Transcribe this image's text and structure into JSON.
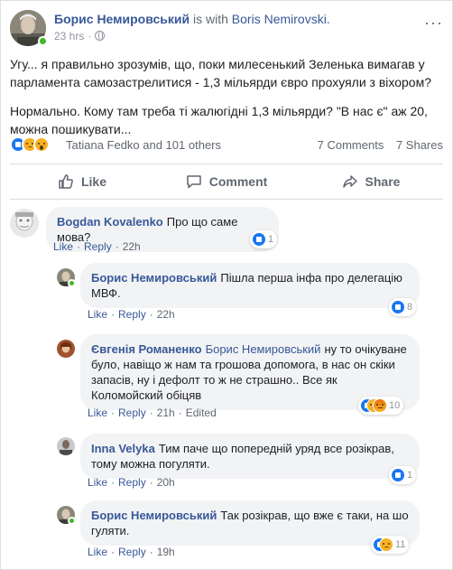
{
  "post": {
    "author": "Борис Немировський",
    "with_text": "is with",
    "tagged": "Boris Nemirovski.",
    "time": "23 hrs",
    "dot": "·",
    "more": "···",
    "paragraphs": [
      "Угу... я правильно зрозумів, що, поки милесенький Зеленька вимагав у парламента самозастрелитися - 1,3 мільярди євро прохуяли з віхором?",
      "Нормально. Кому там треба ті жалюгідні 1,3 мільярди? \"В нас є\" аж 20, можна пошикувати..."
    ],
    "reactions_text": "Tatiana Fedko and 101 others",
    "comments_count": "7 Comments",
    "shares_count": "7 Shares"
  },
  "actions": {
    "like": "Like",
    "comment": "Comment",
    "share": "Share"
  },
  "comments": [
    {
      "name": "Bogdan Kovalenko",
      "tag": "",
      "text": "Про що саме мова?",
      "like": "Like",
      "reply": "Reply",
      "time": "22h",
      "edited": "",
      "reaction_count": "1"
    },
    {
      "name": "Борис Немировський",
      "tag": "",
      "text": "Пішла перша інфа про делегацію МВФ.",
      "like": "Like",
      "reply": "Reply",
      "time": "22h",
      "edited": "",
      "reaction_count": "8"
    },
    {
      "name": "Євгенія Романенко",
      "tag": "Борис Немировський",
      "text": "ну то очікуване було, навіщо ж нам та грошова допомога, в нас он скіки запасів, ну і дефолт то ж не страшно.. Все як Коломойский обіцяв",
      "like": "Like",
      "reply": "Reply",
      "time": "21h",
      "edited": "Edited",
      "reaction_count": "10"
    },
    {
      "name": "Inna Velyka",
      "tag": "",
      "text": "Тим паче що попередній уряд все розікрав, тому можна погуляти.",
      "like": "Like",
      "reply": "Reply",
      "time": "20h",
      "edited": "",
      "reaction_count": "1"
    },
    {
      "name": "Борис Немировський",
      "tag": "",
      "text": "Так розікрав, що вже є таки, на шо гуляти.",
      "like": "Like",
      "reply": "Reply",
      "time": "19h",
      "edited": "",
      "reaction_count": "11"
    }
  ],
  "colors": {
    "link": "#385898",
    "like_blue": "#1877f2",
    "online": "#42b72a",
    "bubble": "#f2f3f5"
  }
}
